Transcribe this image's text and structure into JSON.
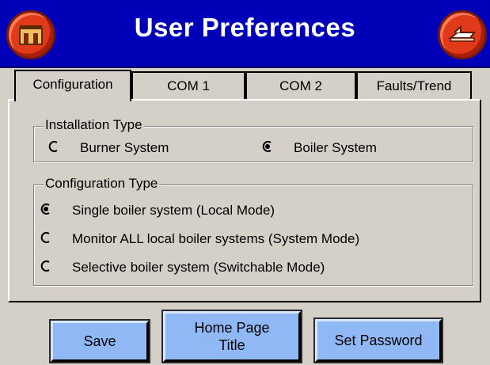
{
  "header": {
    "title": "User Preferences",
    "home_icon": "home-icon",
    "back_icon": "back-icon"
  },
  "tabs": [
    {
      "label": "Configuration",
      "active": true
    },
    {
      "label": "COM 1",
      "active": false
    },
    {
      "label": "COM 2",
      "active": false
    },
    {
      "label": "Faults/Trend",
      "active": false
    }
  ],
  "installation": {
    "legend": "Installation Type",
    "options": [
      {
        "label": "Burner System",
        "selected": false
      },
      {
        "label": "Boiler System",
        "selected": true
      }
    ]
  },
  "configuration": {
    "legend": "Configuration Type",
    "options": [
      {
        "label": "Single boiler system (Local Mode)",
        "selected": true
      },
      {
        "label": "Monitor ALL local boiler systems (System Mode)",
        "selected": false
      },
      {
        "label": "Selective boiler system (Switchable Mode)",
        "selected": false
      }
    ]
  },
  "buttons": {
    "save": "Save",
    "home_line1": "Home Page",
    "home_line2": "Title",
    "password": "Set Password"
  },
  "colors": {
    "titlebar": "#0000b8",
    "button": "#8fb8f5",
    "icon_red": "#e03a1a",
    "background": "#d4d0c8"
  }
}
